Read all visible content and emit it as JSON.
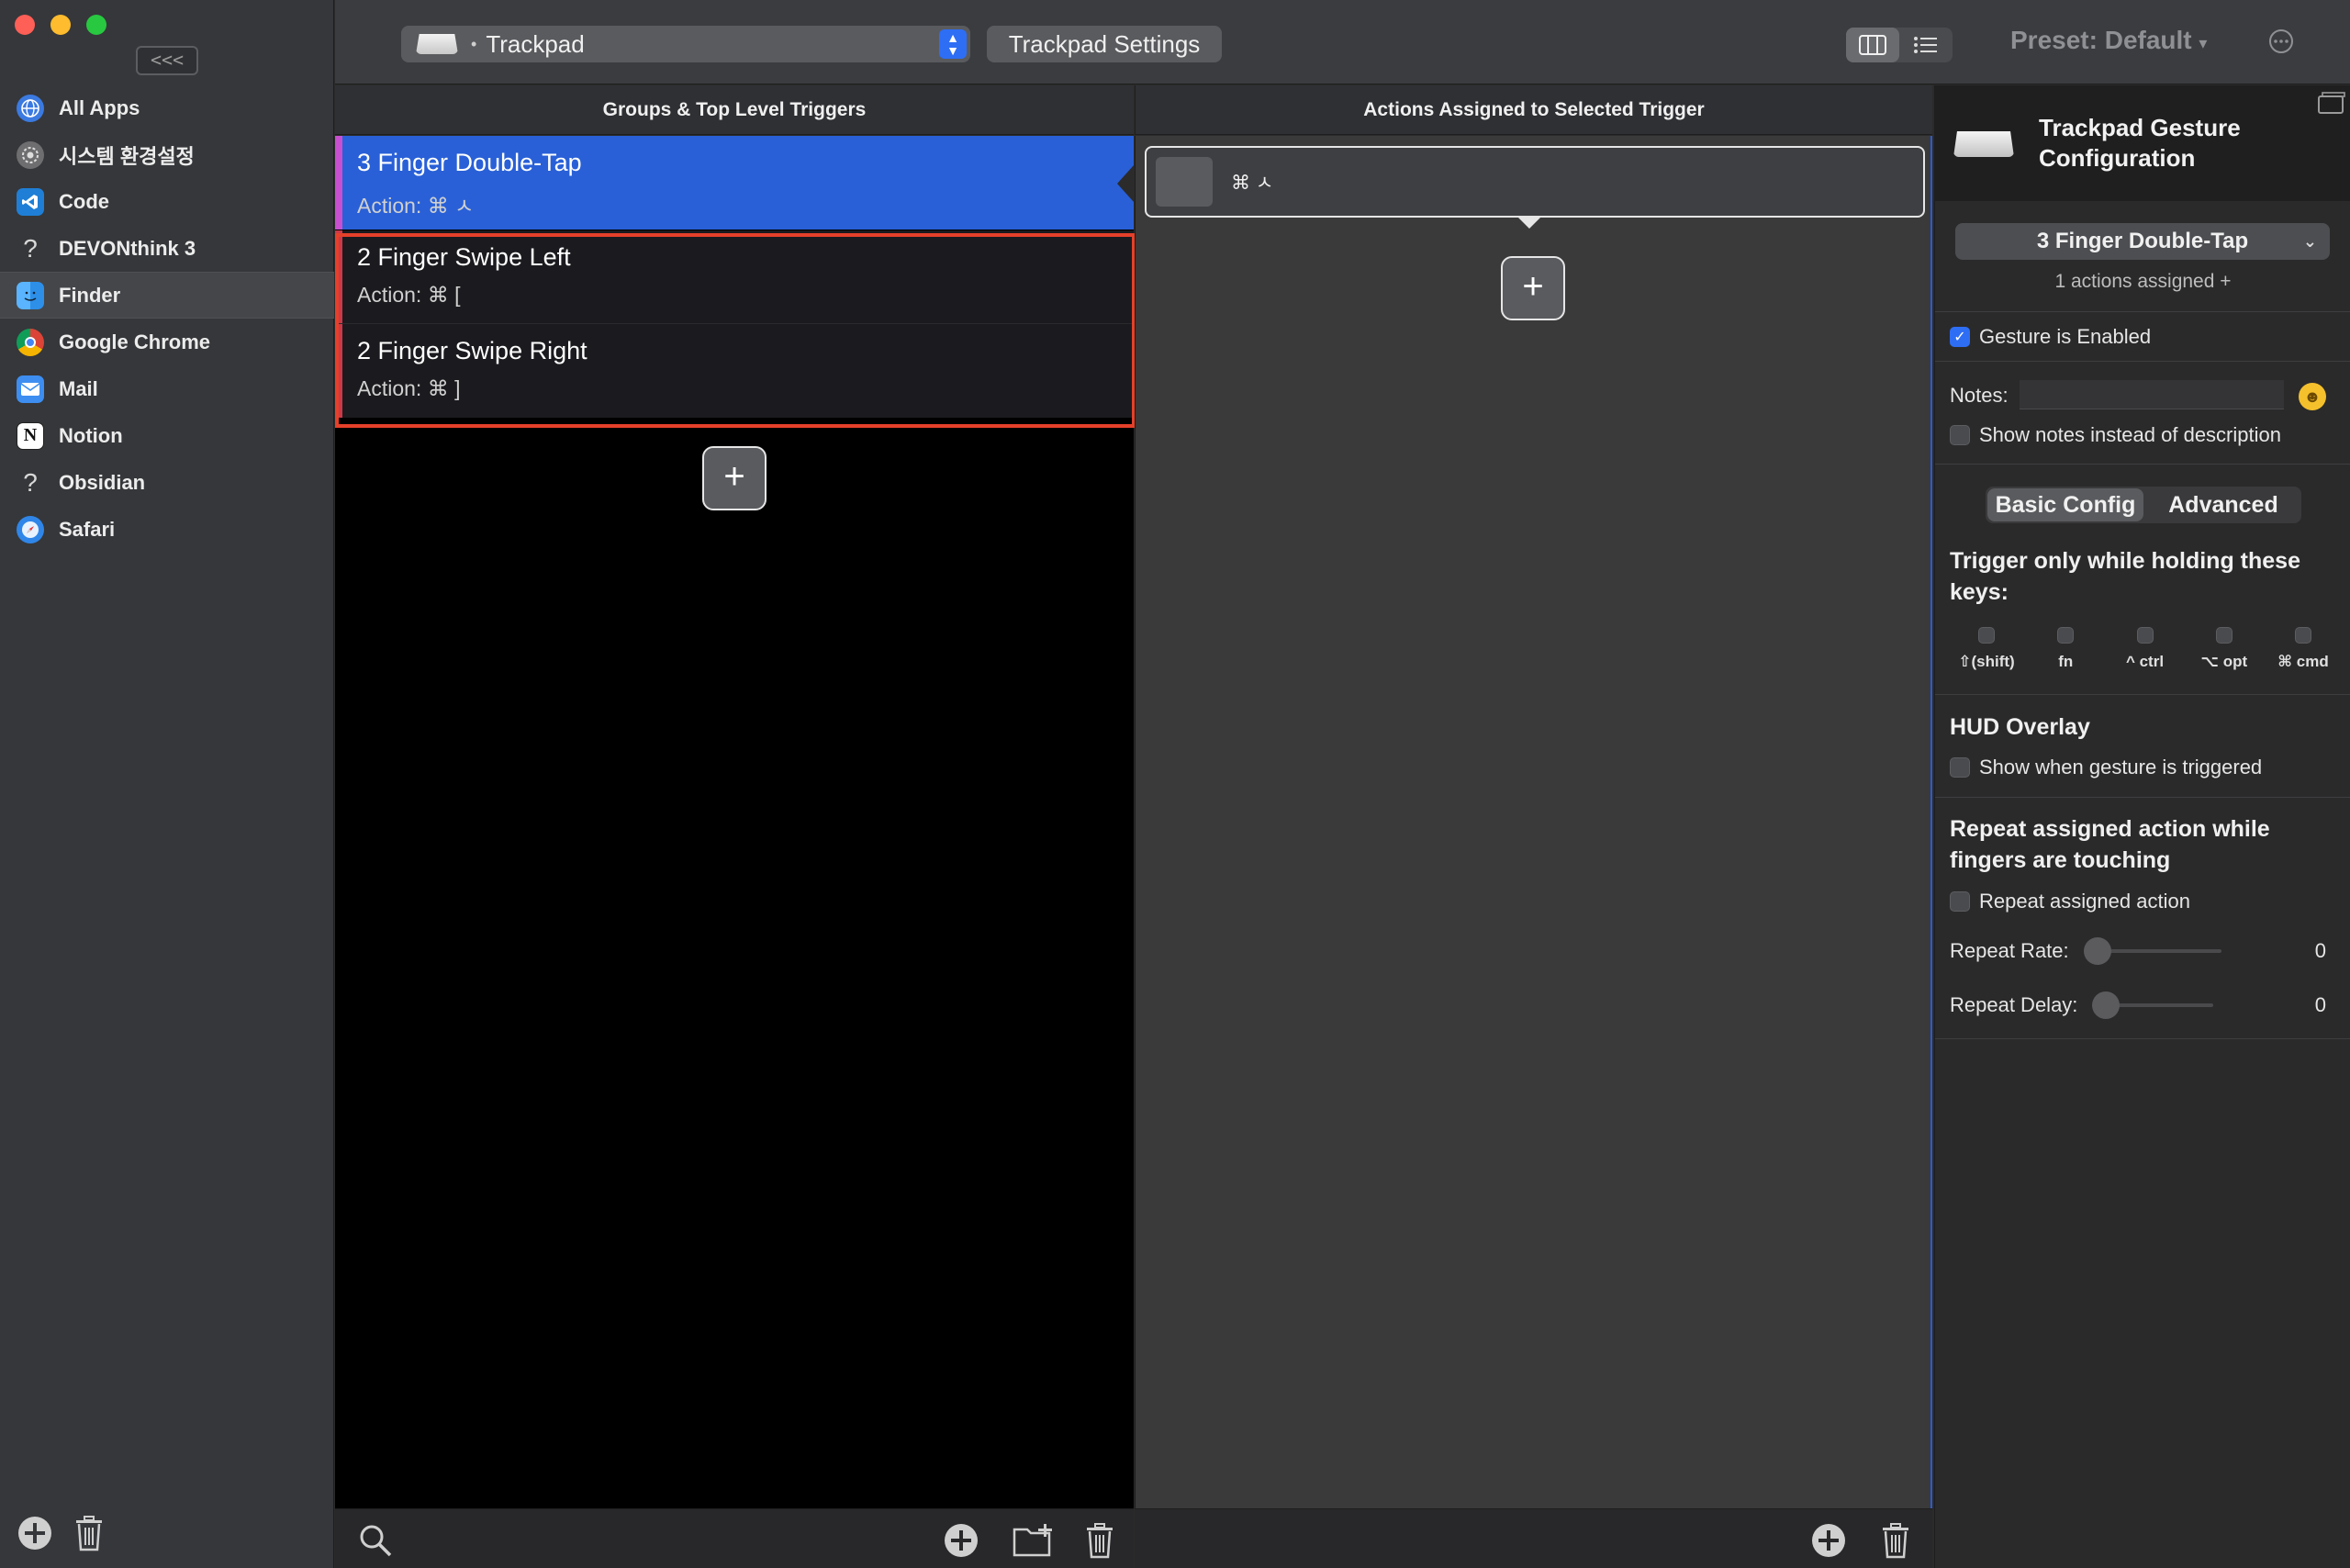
{
  "sidebar": {
    "collapse_label": "<<<",
    "apps": [
      {
        "name": "All Apps",
        "icon": "globe-icon",
        "color": "#3b7ae0"
      },
      {
        "name": "시스템 환경설정",
        "icon": "system-preferences-icon",
        "color": "#6e6e70"
      },
      {
        "name": "Code",
        "icon": "vscode-icon",
        "color": "#1f7fd6"
      },
      {
        "name": "DEVONthink 3",
        "icon": "question-icon",
        "color": ""
      },
      {
        "name": "Finder",
        "icon": "finder-icon",
        "color": "#2d8fe8",
        "selected": true
      },
      {
        "name": "Google Chrome",
        "icon": "chrome-icon",
        "color": "#e9e9e9"
      },
      {
        "name": "Mail",
        "icon": "mail-icon",
        "color": "#3d8ef0"
      },
      {
        "name": "Notion",
        "icon": "notion-icon",
        "color": "#ffffff"
      },
      {
        "name": "Obsidian",
        "icon": "question-icon",
        "color": ""
      },
      {
        "name": "Safari",
        "icon": "safari-icon",
        "color": "#2f86e8"
      }
    ]
  },
  "toolbar": {
    "device": "Trackpad",
    "settings_button": "Trackpad Settings",
    "preset": "Preset: Default"
  },
  "columns": {
    "groups_header": "Groups & Top Level Triggers",
    "actions_header": "Actions Assigned to Selected Trigger"
  },
  "triggers": [
    {
      "title": "3 Finger Double-Tap",
      "action": "Action: ⌘ ㅅ"
    },
    {
      "title": "2 Finger Swipe Left",
      "action": "Action: ⌘ ["
    },
    {
      "title": "2 Finger Swipe Right",
      "action": "Action: ⌘ ]"
    }
  ],
  "assigned_action": {
    "shortcut": "⌘ ㅅ"
  },
  "inspector": {
    "title": "Trackpad Gesture Configuration",
    "selected_trigger": "3 Finger Double-Tap",
    "actions_assigned": "1 actions assigned +",
    "gesture_enabled_label": "Gesture is Enabled",
    "gesture_enabled": true,
    "notes_label": "Notes:",
    "notes_value": "",
    "show_notes_label": "Show notes instead of description",
    "tabs": {
      "basic": "Basic Config",
      "advanced": "Advanced"
    },
    "trigger_keys_title": "Trigger only while holding these keys:",
    "modifiers": [
      "⇧(shift)",
      "fn",
      "^ ctrl",
      "⌥ opt",
      "⌘ cmd"
    ],
    "hud_title": "HUD Overlay",
    "hud_label": "Show when gesture is triggered",
    "repeat_title": "Repeat assigned action while fingers are touching",
    "repeat_label": "Repeat assigned action",
    "repeat_rate_label": "Repeat Rate:",
    "repeat_rate_value": "0",
    "repeat_delay_label": "Repeat Delay:",
    "repeat_delay_value": "0"
  }
}
